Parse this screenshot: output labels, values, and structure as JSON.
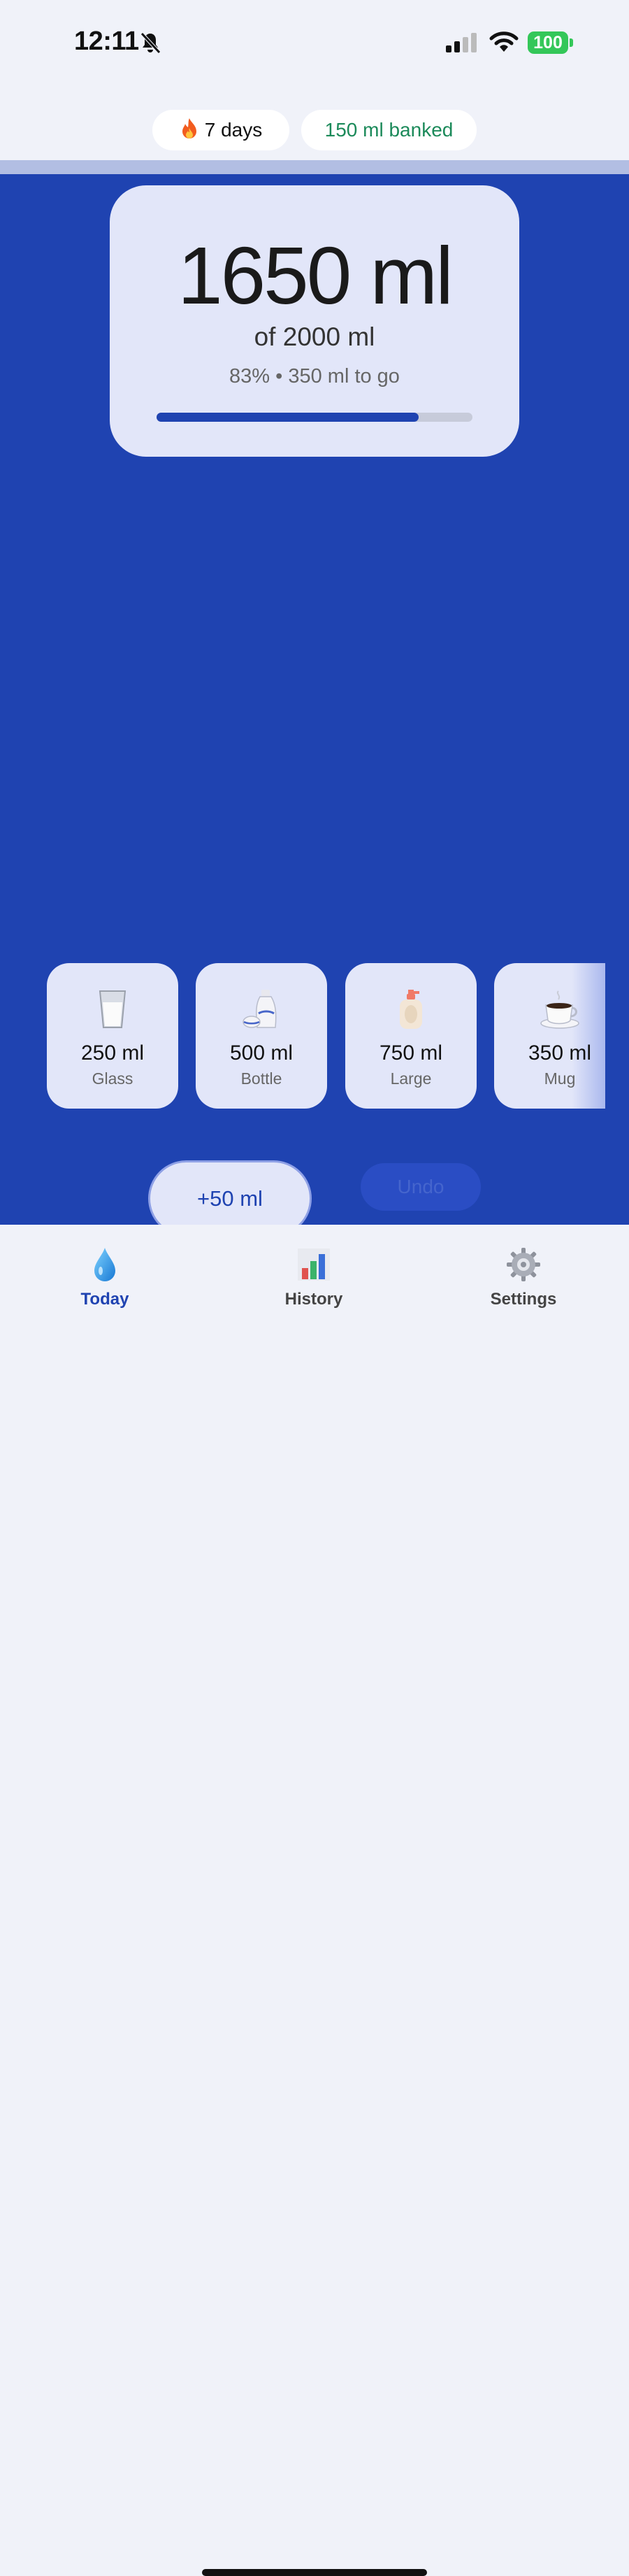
{
  "status_bar": {
    "time": "12:11",
    "battery": "100",
    "icons": [
      "bell-slash-icon",
      "signal-icon",
      "wifi-icon",
      "battery-icon"
    ]
  },
  "header": {
    "streak_icon": "flame-icon",
    "streak_label": "7 days",
    "banked_label": "150 ml banked"
  },
  "progress": {
    "amount": "1650 ml",
    "goal": "of 2000 ml",
    "remaining": "83% • 350 ml to go",
    "fraction": 0.83
  },
  "drinks": [
    {
      "amount": "250 ml",
      "label": "Glass",
      "icon": "glass-icon"
    },
    {
      "amount": "500 ml",
      "label": "Bottle",
      "icon": "bottle-icon"
    },
    {
      "amount": "750 ml",
      "label": "Large",
      "icon": "large-bottle-icon"
    },
    {
      "amount": "350 ml",
      "label": "Mug",
      "icon": "mug-icon"
    }
  ],
  "actions": {
    "add_small": "+50 ml",
    "undo": "Undo"
  },
  "tabs": [
    {
      "label": "Today",
      "icon": "water-drop-icon",
      "active": true
    },
    {
      "label": "History",
      "icon": "bar-chart-icon",
      "active": false
    },
    {
      "label": "Settings",
      "icon": "gear-icon",
      "active": false
    }
  ],
  "colors": {
    "accent": "#1f43b1",
    "card": "#e2e6f9",
    "banked_text": "#1c8a5a",
    "battery": "#34c759"
  }
}
